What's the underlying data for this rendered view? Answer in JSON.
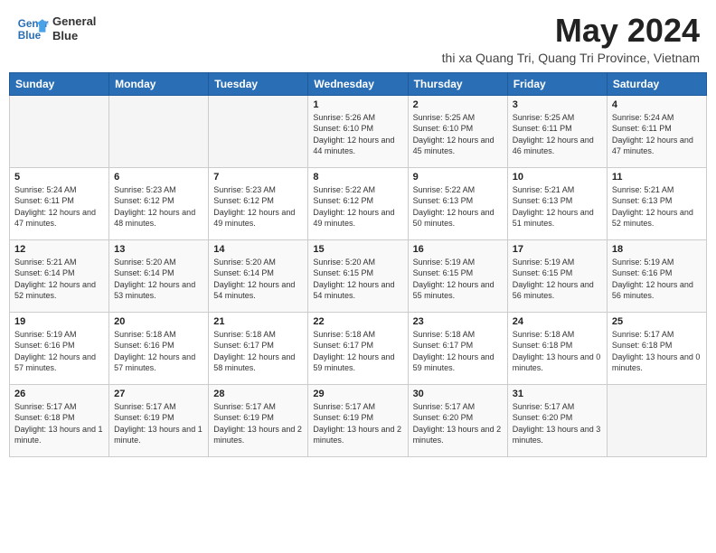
{
  "header": {
    "logo_line1": "General",
    "logo_line2": "Blue",
    "month": "May 2024",
    "location": "thi xa Quang Tri, Quang Tri Province, Vietnam"
  },
  "days_of_week": [
    "Sunday",
    "Monday",
    "Tuesday",
    "Wednesday",
    "Thursday",
    "Friday",
    "Saturday"
  ],
  "weeks": [
    [
      {
        "day": "",
        "sunrise": "",
        "sunset": "",
        "daylight": ""
      },
      {
        "day": "",
        "sunrise": "",
        "sunset": "",
        "daylight": ""
      },
      {
        "day": "",
        "sunrise": "",
        "sunset": "",
        "daylight": ""
      },
      {
        "day": "1",
        "sunrise": "Sunrise: 5:26 AM",
        "sunset": "Sunset: 6:10 PM",
        "daylight": "Daylight: 12 hours and 44 minutes."
      },
      {
        "day": "2",
        "sunrise": "Sunrise: 5:25 AM",
        "sunset": "Sunset: 6:10 PM",
        "daylight": "Daylight: 12 hours and 45 minutes."
      },
      {
        "day": "3",
        "sunrise": "Sunrise: 5:25 AM",
        "sunset": "Sunset: 6:11 PM",
        "daylight": "Daylight: 12 hours and 46 minutes."
      },
      {
        "day": "4",
        "sunrise": "Sunrise: 5:24 AM",
        "sunset": "Sunset: 6:11 PM",
        "daylight": "Daylight: 12 hours and 47 minutes."
      }
    ],
    [
      {
        "day": "5",
        "sunrise": "Sunrise: 5:24 AM",
        "sunset": "Sunset: 6:11 PM",
        "daylight": "Daylight: 12 hours and 47 minutes."
      },
      {
        "day": "6",
        "sunrise": "Sunrise: 5:23 AM",
        "sunset": "Sunset: 6:12 PM",
        "daylight": "Daylight: 12 hours and 48 minutes."
      },
      {
        "day": "7",
        "sunrise": "Sunrise: 5:23 AM",
        "sunset": "Sunset: 6:12 PM",
        "daylight": "Daylight: 12 hours and 49 minutes."
      },
      {
        "day": "8",
        "sunrise": "Sunrise: 5:22 AM",
        "sunset": "Sunset: 6:12 PM",
        "daylight": "Daylight: 12 hours and 49 minutes."
      },
      {
        "day": "9",
        "sunrise": "Sunrise: 5:22 AM",
        "sunset": "Sunset: 6:13 PM",
        "daylight": "Daylight: 12 hours and 50 minutes."
      },
      {
        "day": "10",
        "sunrise": "Sunrise: 5:21 AM",
        "sunset": "Sunset: 6:13 PM",
        "daylight": "Daylight: 12 hours and 51 minutes."
      },
      {
        "day": "11",
        "sunrise": "Sunrise: 5:21 AM",
        "sunset": "Sunset: 6:13 PM",
        "daylight": "Daylight: 12 hours and 52 minutes."
      }
    ],
    [
      {
        "day": "12",
        "sunrise": "Sunrise: 5:21 AM",
        "sunset": "Sunset: 6:14 PM",
        "daylight": "Daylight: 12 hours and 52 minutes."
      },
      {
        "day": "13",
        "sunrise": "Sunrise: 5:20 AM",
        "sunset": "Sunset: 6:14 PM",
        "daylight": "Daylight: 12 hours and 53 minutes."
      },
      {
        "day": "14",
        "sunrise": "Sunrise: 5:20 AM",
        "sunset": "Sunset: 6:14 PM",
        "daylight": "Daylight: 12 hours and 54 minutes."
      },
      {
        "day": "15",
        "sunrise": "Sunrise: 5:20 AM",
        "sunset": "Sunset: 6:15 PM",
        "daylight": "Daylight: 12 hours and 54 minutes."
      },
      {
        "day": "16",
        "sunrise": "Sunrise: 5:19 AM",
        "sunset": "Sunset: 6:15 PM",
        "daylight": "Daylight: 12 hours and 55 minutes."
      },
      {
        "day": "17",
        "sunrise": "Sunrise: 5:19 AM",
        "sunset": "Sunset: 6:15 PM",
        "daylight": "Daylight: 12 hours and 56 minutes."
      },
      {
        "day": "18",
        "sunrise": "Sunrise: 5:19 AM",
        "sunset": "Sunset: 6:16 PM",
        "daylight": "Daylight: 12 hours and 56 minutes."
      }
    ],
    [
      {
        "day": "19",
        "sunrise": "Sunrise: 5:19 AM",
        "sunset": "Sunset: 6:16 PM",
        "daylight": "Daylight: 12 hours and 57 minutes."
      },
      {
        "day": "20",
        "sunrise": "Sunrise: 5:18 AM",
        "sunset": "Sunset: 6:16 PM",
        "daylight": "Daylight: 12 hours and 57 minutes."
      },
      {
        "day": "21",
        "sunrise": "Sunrise: 5:18 AM",
        "sunset": "Sunset: 6:17 PM",
        "daylight": "Daylight: 12 hours and 58 minutes."
      },
      {
        "day": "22",
        "sunrise": "Sunrise: 5:18 AM",
        "sunset": "Sunset: 6:17 PM",
        "daylight": "Daylight: 12 hours and 59 minutes."
      },
      {
        "day": "23",
        "sunrise": "Sunrise: 5:18 AM",
        "sunset": "Sunset: 6:17 PM",
        "daylight": "Daylight: 12 hours and 59 minutes."
      },
      {
        "day": "24",
        "sunrise": "Sunrise: 5:18 AM",
        "sunset": "Sunset: 6:18 PM",
        "daylight": "Daylight: 13 hours and 0 minutes."
      },
      {
        "day": "25",
        "sunrise": "Sunrise: 5:17 AM",
        "sunset": "Sunset: 6:18 PM",
        "daylight": "Daylight: 13 hours and 0 minutes."
      }
    ],
    [
      {
        "day": "26",
        "sunrise": "Sunrise: 5:17 AM",
        "sunset": "Sunset: 6:18 PM",
        "daylight": "Daylight: 13 hours and 1 minute."
      },
      {
        "day": "27",
        "sunrise": "Sunrise: 5:17 AM",
        "sunset": "Sunset: 6:19 PM",
        "daylight": "Daylight: 13 hours and 1 minute."
      },
      {
        "day": "28",
        "sunrise": "Sunrise: 5:17 AM",
        "sunset": "Sunset: 6:19 PM",
        "daylight": "Daylight: 13 hours and 2 minutes."
      },
      {
        "day": "29",
        "sunrise": "Sunrise: 5:17 AM",
        "sunset": "Sunset: 6:19 PM",
        "daylight": "Daylight: 13 hours and 2 minutes."
      },
      {
        "day": "30",
        "sunrise": "Sunrise: 5:17 AM",
        "sunset": "Sunset: 6:20 PM",
        "daylight": "Daylight: 13 hours and 2 minutes."
      },
      {
        "day": "31",
        "sunrise": "Sunrise: 5:17 AM",
        "sunset": "Sunset: 6:20 PM",
        "daylight": "Daylight: 13 hours and 3 minutes."
      },
      {
        "day": "",
        "sunrise": "",
        "sunset": "",
        "daylight": ""
      }
    ]
  ]
}
